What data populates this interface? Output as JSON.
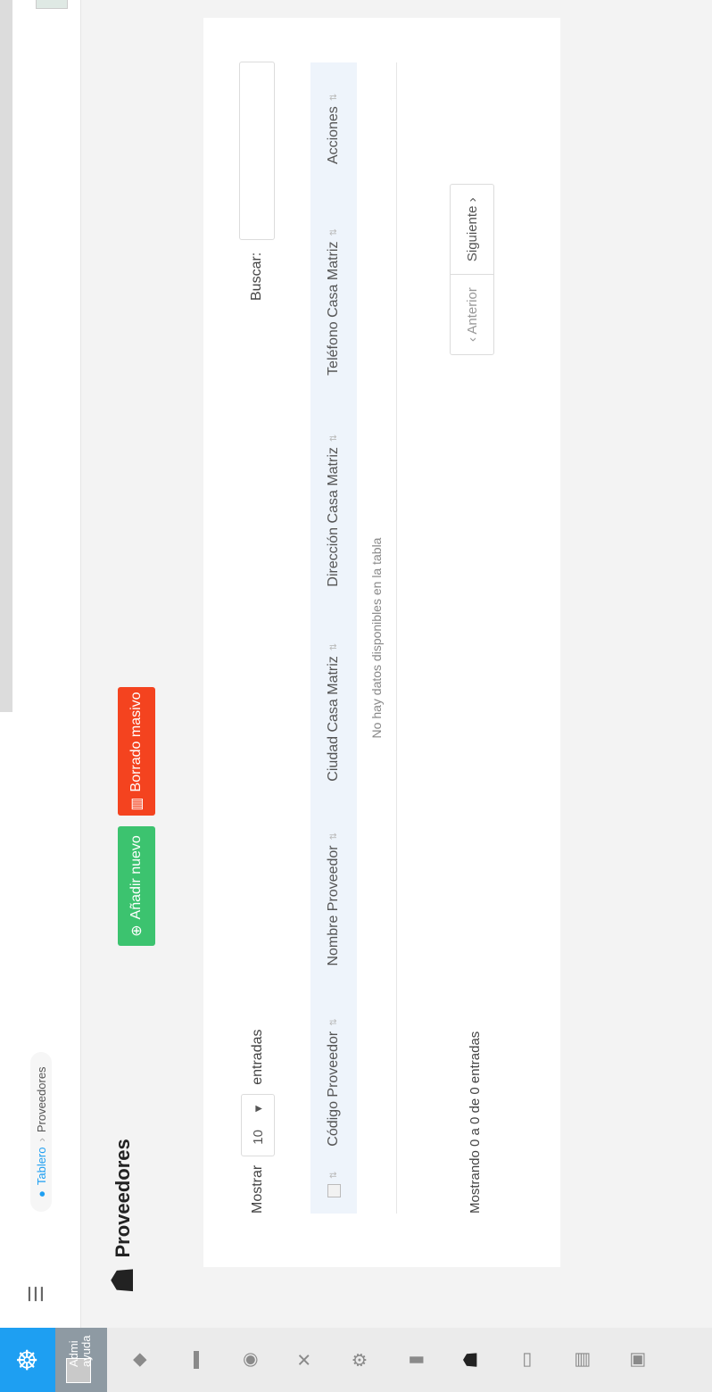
{
  "sidebar": {
    "user": {
      "name_lines": [
        "Admi",
        "ayuda"
      ]
    }
  },
  "icons": {
    "app_logo": "ship-wheel-icon",
    "menu": "hamburger-icon",
    "home": "home-icon",
    "providers": "users-group-icon"
  },
  "breadcrumb": {
    "home": "Tablero",
    "separator": "›",
    "current": "Proveedores"
  },
  "page": {
    "title": "Proveedores",
    "add_button": "Añadir nuevo",
    "bulk_delete_button": "Borrado masivo"
  },
  "table": {
    "length_label_before": "Mostrar",
    "length_value": "10",
    "length_label_after": "entradas",
    "search_label": "Buscar:",
    "search_value": "",
    "columns": [
      "Código Proveedor",
      "Nombre Proveedor",
      "Ciudad Casa Matriz",
      "Dirección Casa Matriz",
      "Teléfono Casa Matriz",
      "Acciones"
    ],
    "empty_message": "No hay datos disponibles en la tabla",
    "info": "Mostrando 0 a 0 de 0 entradas",
    "pagination": {
      "prev": "‹ Anterior",
      "next": "Siguiente ›"
    }
  },
  "colors": {
    "accent": "#1e9ff2",
    "add": "#3cc36f",
    "delete": "#f4431f"
  }
}
